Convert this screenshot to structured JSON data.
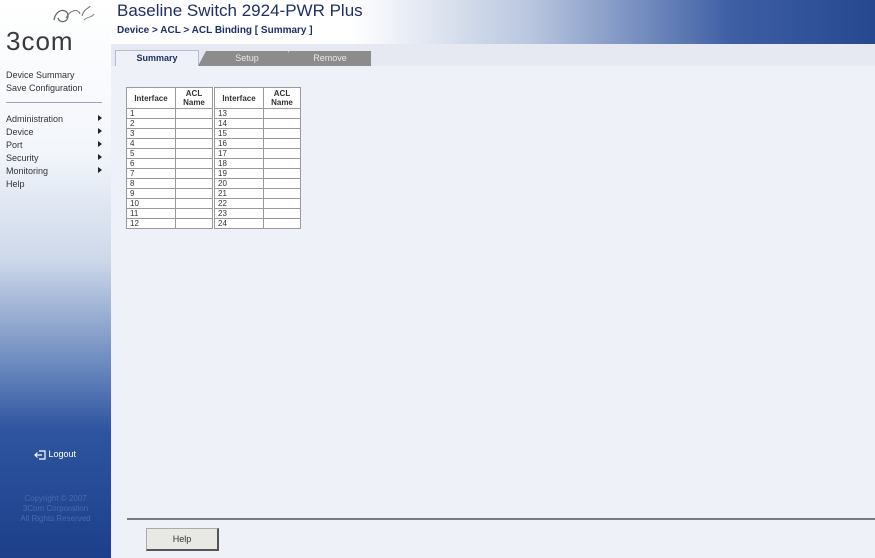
{
  "header": {
    "product_title": "Baseline Switch 2924-PWR Plus",
    "breadcrumb": "Device > ACL > ACL Binding [ Summary ]"
  },
  "sidebar": {
    "logo_text": "3com",
    "quick_links": [
      "Device Summary",
      "Save Configuration"
    ],
    "menu": [
      "Administration",
      "Device",
      "Port",
      "Security",
      "Monitoring",
      "Help"
    ],
    "logout_label": "Logout",
    "copyright": [
      "Copyright © 2007",
      "3Com Corporation",
      "All Rights Reserved"
    ]
  },
  "tabs": [
    {
      "label": "Summary",
      "active": true
    },
    {
      "label": "Setup",
      "active": false
    },
    {
      "label": "Remove",
      "active": false
    }
  ],
  "table": {
    "headers": [
      "Interface",
      "ACL Name",
      "Interface",
      "ACL Name"
    ],
    "rows": [
      [
        "1",
        "",
        "13",
        ""
      ],
      [
        "2",
        "",
        "14",
        ""
      ],
      [
        "3",
        "",
        "15",
        ""
      ],
      [
        "4",
        "",
        "16",
        ""
      ],
      [
        "5",
        "",
        "17",
        ""
      ],
      [
        "6",
        "",
        "18",
        ""
      ],
      [
        "7",
        "",
        "19",
        ""
      ],
      [
        "8",
        "",
        "20",
        ""
      ],
      [
        "9",
        "",
        "21",
        ""
      ],
      [
        "10",
        "",
        "22",
        ""
      ],
      [
        "11",
        "",
        "23",
        ""
      ],
      [
        "12",
        "",
        "24",
        ""
      ]
    ]
  },
  "footer": {
    "help_button": "Help"
  }
}
